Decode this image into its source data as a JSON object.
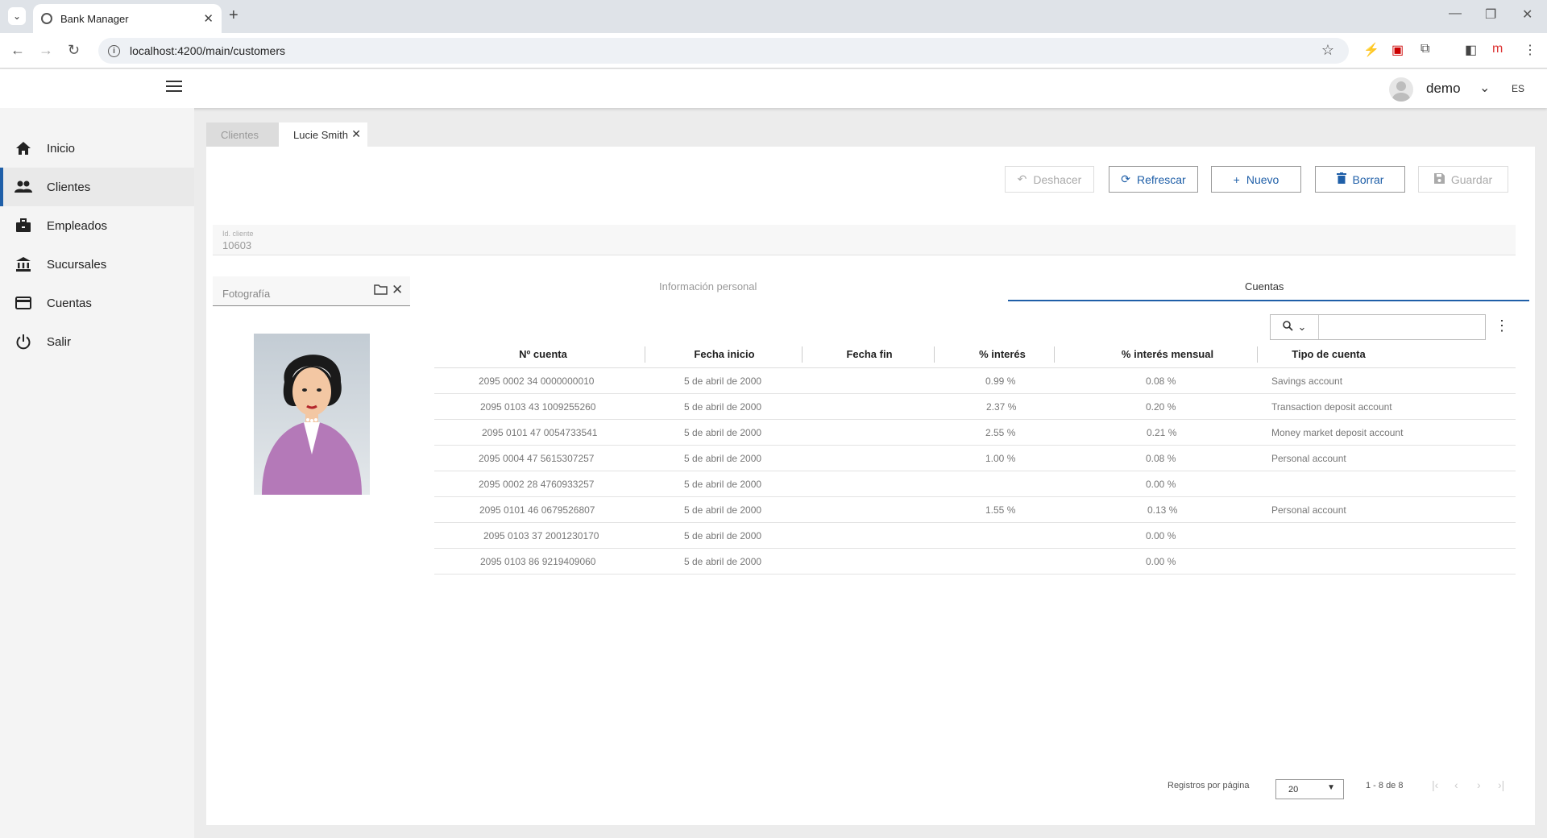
{
  "browser": {
    "tab_title": "Bank Manager",
    "url": "localhost:4200/main/customers"
  },
  "header": {
    "username": "demo",
    "language": "ES"
  },
  "sidebar": {
    "items": [
      {
        "label": "Inicio",
        "icon": "home-icon"
      },
      {
        "label": "Clientes",
        "icon": "people-icon"
      },
      {
        "label": "Empleados",
        "icon": "briefcase-icon"
      },
      {
        "label": "Sucursales",
        "icon": "bank-icon"
      },
      {
        "label": "Cuentas",
        "icon": "credit-card-icon"
      },
      {
        "label": "Salir",
        "icon": "power-icon"
      }
    ],
    "active_index": 1
  },
  "content_tabs": {
    "tab1": "Clientes",
    "tab2": "Lucie Smith"
  },
  "toolbar": {
    "undo": "Deshacer",
    "refresh": "Refrescar",
    "new": "Nuevo",
    "delete": "Borrar",
    "save": "Guardar"
  },
  "form": {
    "id_label": "Id. cliente",
    "id_value": "10603",
    "photo_label": "Fotografía"
  },
  "subtabs": {
    "personal": "Información personal",
    "accounts": "Cuentas"
  },
  "grid": {
    "columns": [
      "Nº cuenta",
      "Fecha inicio",
      "Fecha fin",
      "% interés",
      "% interés mensual",
      "Tipo de cuenta"
    ],
    "rows": [
      [
        "2095 0002 34 0000000010",
        "5 de abril de 2000",
        "",
        "0.99 %",
        "0.08 %",
        "Savings account"
      ],
      [
        "2095 0103 43 1009255260",
        "5 de abril de 2000",
        "",
        "2.37 %",
        "0.20 %",
        "Transaction deposit account"
      ],
      [
        "2095 0101 47 0054733541",
        "5 de abril de 2000",
        "",
        "2.55 %",
        "0.21 %",
        "Money market deposit account"
      ],
      [
        "2095 0004 47 5615307257",
        "5 de abril de 2000",
        "",
        "1.00 %",
        "0.08 %",
        "Personal account"
      ],
      [
        "2095 0002 28 4760933257",
        "5 de abril de 2000",
        "",
        "",
        "0.00 %",
        ""
      ],
      [
        "2095 0101 46 0679526807",
        "5 de abril de 2000",
        "",
        "1.55 %",
        "0.13 %",
        "Personal account"
      ],
      [
        "2095 0103 37 2001230170",
        "5 de abril de 2000",
        "",
        "",
        "0.00 %",
        ""
      ],
      [
        "2095 0103 86 9219409060",
        "5 de abril de 2000",
        "",
        "",
        "0.00 %",
        ""
      ]
    ]
  },
  "pager": {
    "label": "Registros por página",
    "page_size": "20",
    "range": "1 - 8 de 8"
  },
  "colors": {
    "accent": "#1f5fa8",
    "sidebar_bg": "#f4f4f4"
  }
}
